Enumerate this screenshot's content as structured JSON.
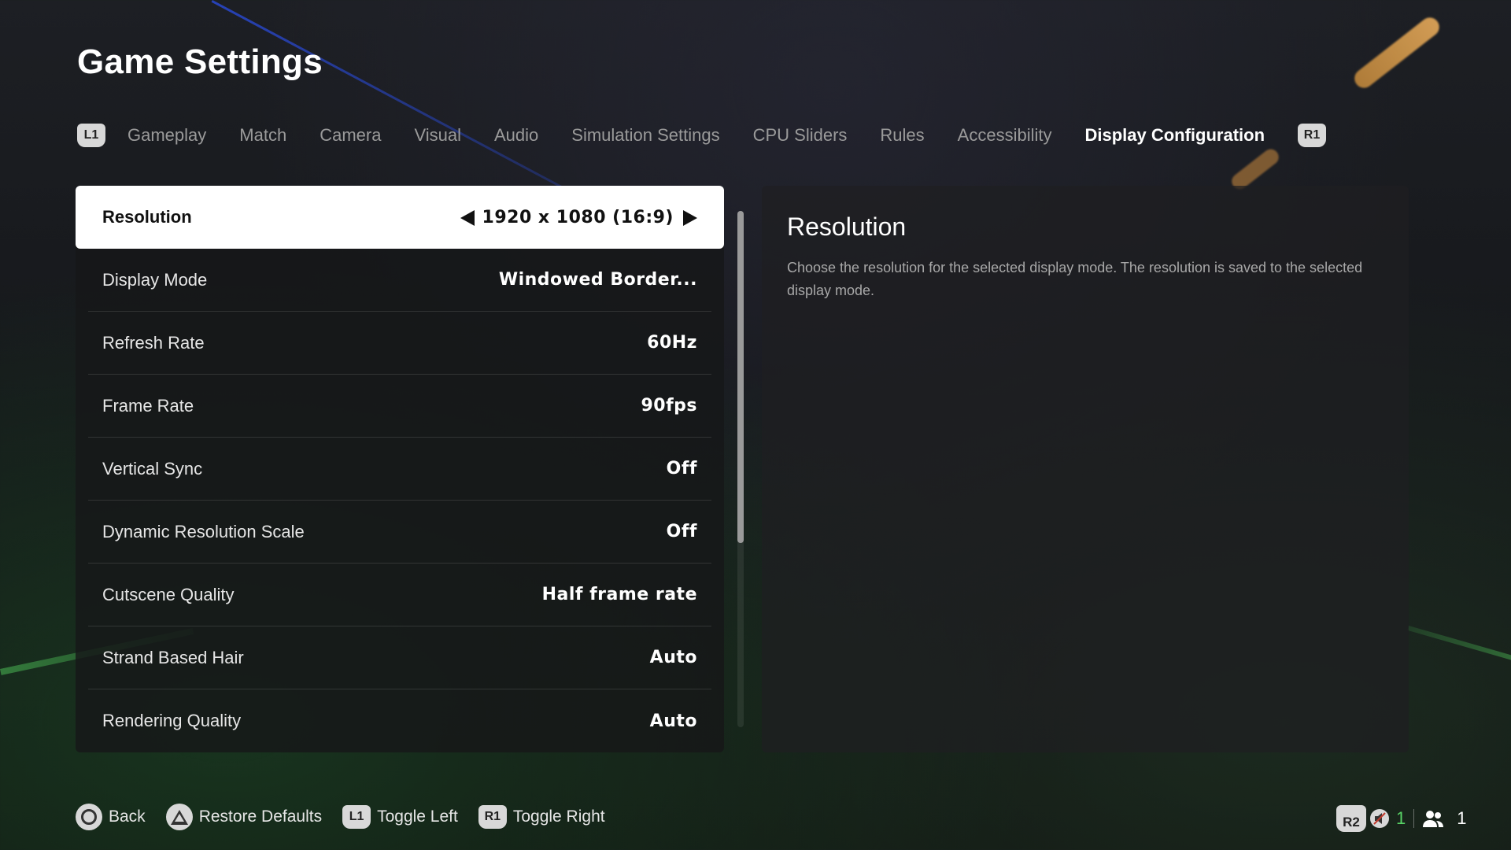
{
  "title": "Game Settings",
  "tabs": {
    "prev_badge": "L1",
    "next_badge": "R1",
    "items": [
      "Gameplay",
      "Match",
      "Camera",
      "Visual",
      "Audio",
      "Simulation Settings",
      "CPU Sliders",
      "Rules",
      "Accessibility",
      "Display Configuration"
    ],
    "active": "Display Configuration"
  },
  "settings": [
    {
      "label": "Resolution",
      "value": "1920 x 1080 (16:9)"
    },
    {
      "label": "Display Mode",
      "value": "Windowed Border..."
    },
    {
      "label": "Refresh Rate",
      "value": "60Hz"
    },
    {
      "label": "Frame Rate",
      "value": "90fps"
    },
    {
      "label": "Vertical Sync",
      "value": "Off"
    },
    {
      "label": "Dynamic Resolution Scale",
      "value": "Off"
    },
    {
      "label": "Cutscene Quality",
      "value": "Half frame rate"
    },
    {
      "label": "Strand Based Hair",
      "value": "Auto"
    },
    {
      "label": "Rendering Quality",
      "value": "Auto"
    }
  ],
  "selected_index": 0,
  "description": {
    "title": "Resolution",
    "text": "Choose the resolution for the selected display mode. The resolution is saved to the selected display mode."
  },
  "footer": {
    "back": "Back",
    "restore": "Restore Defaults",
    "toggle_left_badge": "L1",
    "toggle_left": "Toggle Left",
    "toggle_right_badge": "R1",
    "toggle_right": "Toggle Right"
  },
  "status": {
    "r2_badge": "R2",
    "voice_count": "1",
    "party_count": "1"
  },
  "colors": {
    "accent_green": "#58d466",
    "selected_row_bg": "#ffffff",
    "inactive_tab": "#9a9a9a"
  },
  "icons": [
    "circle-button-icon",
    "triangle-button-icon",
    "speaker-muted-icon",
    "people-icon",
    "arrow-left-icon",
    "arrow-right-icon"
  ]
}
